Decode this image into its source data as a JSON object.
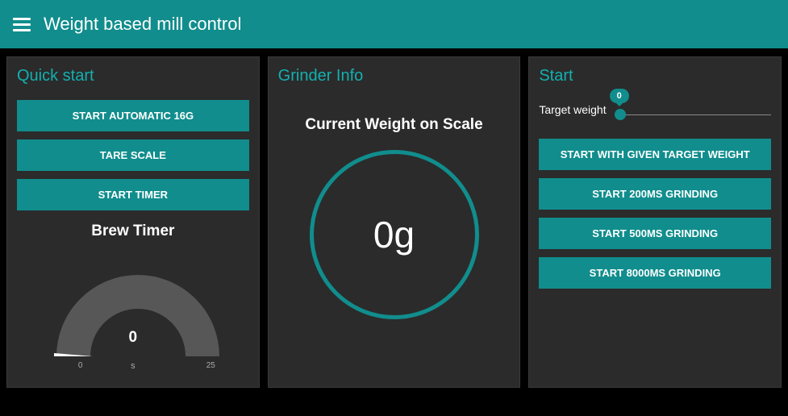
{
  "header": {
    "title": "Weight based mill control"
  },
  "quick_start": {
    "title": "Quick start",
    "buttons": {
      "auto16": "START AUTOMATIC 16G",
      "tare": "TARE SCALE",
      "timer": "START TIMER"
    },
    "brew_timer": {
      "label": "Brew Timer",
      "value": "0",
      "unit": "s",
      "min": "0",
      "max": "25"
    }
  },
  "grinder": {
    "title": "Grinder Info",
    "label": "Current Weight on Scale",
    "value": "0g"
  },
  "start": {
    "title": "Start",
    "slider": {
      "label": "Target weight",
      "value": "0"
    },
    "buttons": {
      "target": "START WITH GIVEN TARGET WEIGHT",
      "g200": "START 200MS GRINDING",
      "g500": "START 500MS GRINDING",
      "g8000": "START 8000MS GRINDING"
    }
  }
}
